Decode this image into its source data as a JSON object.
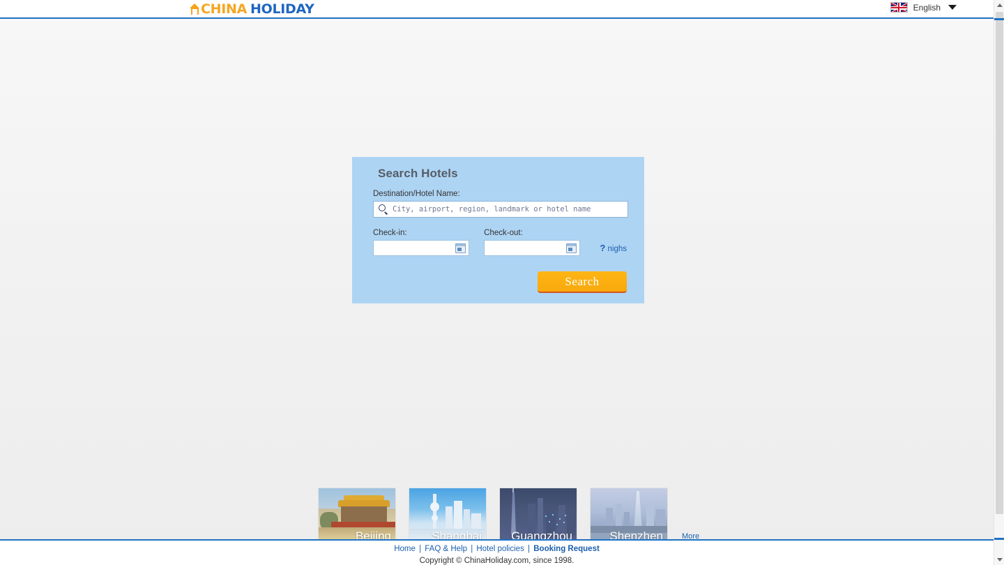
{
  "header": {
    "logo": {
      "part1": "CHINA",
      "part2": "HOLIDAY",
      "house_icon": "house-icon"
    },
    "language": {
      "label": "English",
      "flag_icon": "uk-flag-icon",
      "caret_icon": "chevron-down-icon"
    }
  },
  "search_panel": {
    "title": "Search Hotels",
    "destination": {
      "label": "Destination/Hotel Name:",
      "placeholder": "City, airport, region, landmark or hotel name",
      "value": "",
      "icon": "search-icon"
    },
    "checkin": {
      "label": "Check-in:",
      "value": "",
      "placeholder": "",
      "icon": "calendar-icon"
    },
    "checkout": {
      "label": "Check-out:",
      "value": "",
      "placeholder": "",
      "icon": "calendar-icon"
    },
    "nights": {
      "count": "?",
      "unit": "nighs"
    },
    "search_button": "Search",
    "panel_color": "#aed4f4",
    "button_color": "#fbad12"
  },
  "cities": {
    "items": [
      {
        "name": "Beijing"
      },
      {
        "name": "Shanghai"
      },
      {
        "name": "Guangzhou"
      },
      {
        "name": "Shenzhen"
      }
    ],
    "more_label": "More"
  },
  "footer": {
    "links": [
      {
        "label": "Home",
        "bold": false
      },
      {
        "label": "FAQ & Help",
        "bold": false
      },
      {
        "label": "Hotel policies",
        "bold": false
      },
      {
        "label": "Booking Request",
        "bold": true
      }
    ],
    "separator": "|",
    "copyright": "Copyright © ChinaHoliday.com, since 1998."
  },
  "scrollbar": {
    "up_icon": "scroll-up-arrow-icon",
    "down_icon": "scroll-down-arrow-icon"
  }
}
